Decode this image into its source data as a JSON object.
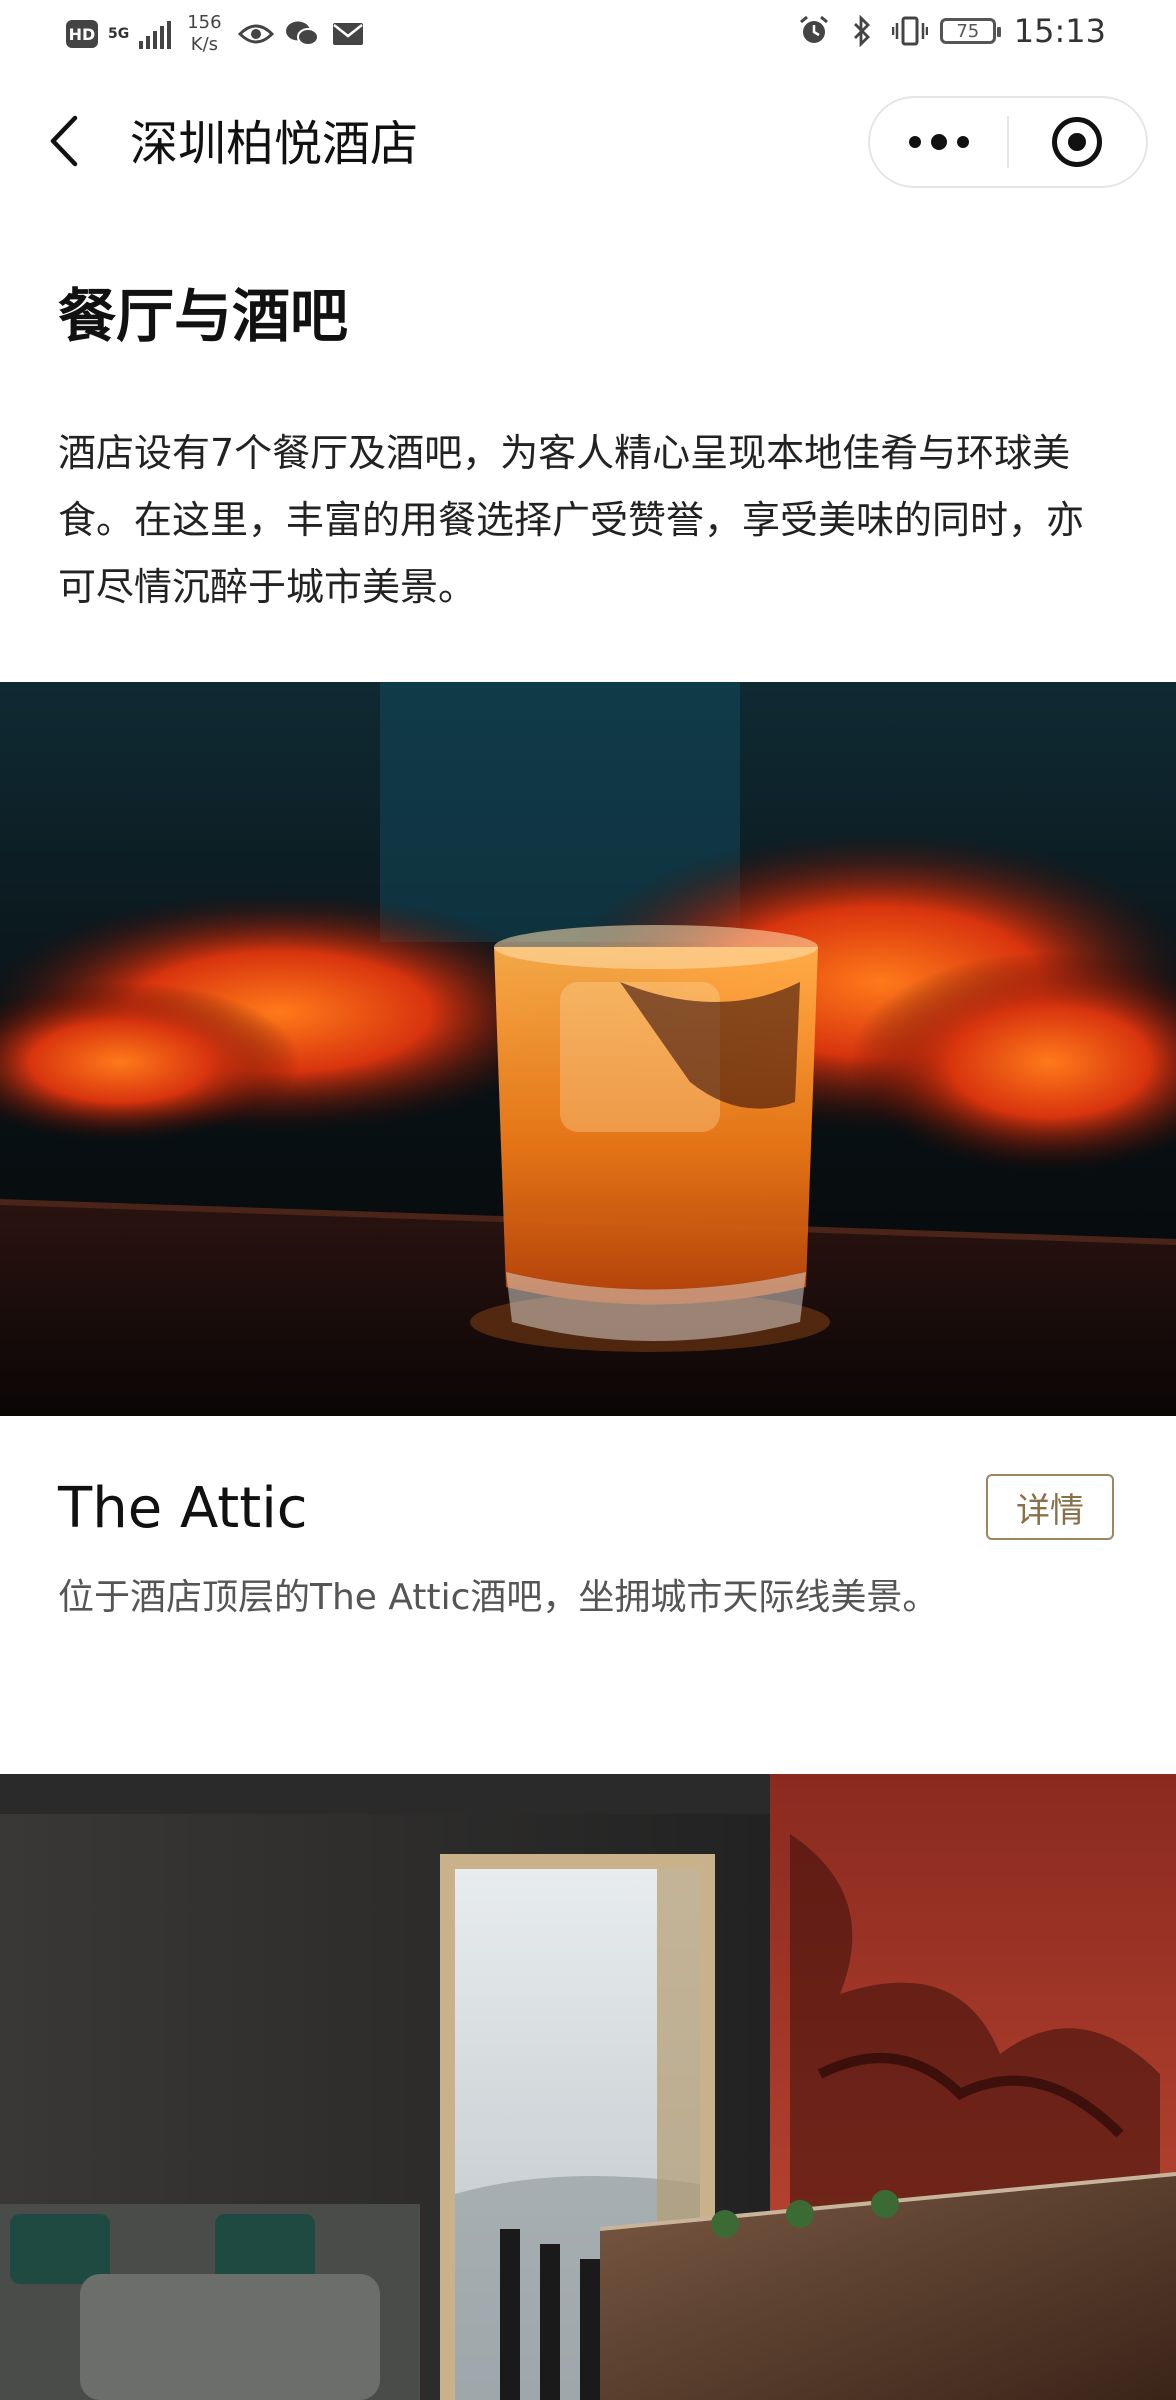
{
  "status_bar": {
    "hd": "HD",
    "network": "5G",
    "speed_value": "156",
    "speed_unit": "K/s",
    "battery": "75",
    "time": "15:13",
    "icons": [
      "eye-icon",
      "wechat-icon",
      "mail-icon",
      "alarm-icon",
      "bluetooth-icon",
      "vibrate-icon"
    ]
  },
  "nav": {
    "title": "深圳柏悦酒店",
    "back_icon": "chevron-left-icon",
    "more_icon": "more-dots-icon",
    "close_icon": "target-circle-icon"
  },
  "section": {
    "title": "餐厅与酒吧",
    "intro": "酒店设有7个餐厅及酒吧，为客人精心呈现本地佳肴与环球美食。在这里，丰富的用餐选择广受赞誉，享受美味的同时，亦可尽情沉醉于城市美景。"
  },
  "venues": [
    {
      "image": "cocktail-glass-photo",
      "name": "The Attic",
      "detail_label": "详情",
      "description": "位于酒店顶层的The Attic酒吧，坐拥城市天际线美景。"
    },
    {
      "image": "restaurant-interior-photo"
    }
  ],
  "colors": {
    "accent_gold": "#9c8560",
    "text_primary": "#111111",
    "text_secondary": "#555555"
  }
}
